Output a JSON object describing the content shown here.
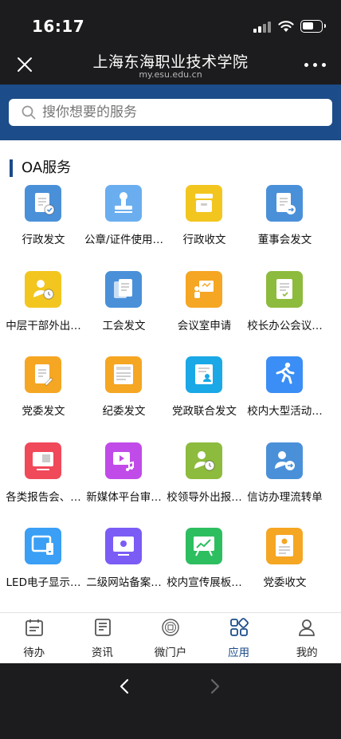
{
  "status": {
    "time": "16:17"
  },
  "header": {
    "title": "上海东海职业技术学院",
    "url": "my.esu.edu.cn"
  },
  "search": {
    "placeholder": "搜你想要的服务"
  },
  "section": {
    "title": "OA服务"
  },
  "apps": [
    {
      "label": "行政发文",
      "icon": "document-check-icon",
      "color": "#4a90d9"
    },
    {
      "label": "公章/证件使用…",
      "icon": "stamp-icon",
      "color": "#6aaef0"
    },
    {
      "label": "行政收文",
      "icon": "inbox-tray-icon",
      "color": "#f2c61f"
    },
    {
      "label": "董事会发文",
      "icon": "document-send-icon",
      "color": "#4a90d9"
    },
    {
      "label": "中层干部外出…",
      "icon": "person-clock-icon",
      "color": "#f2c61f"
    },
    {
      "label": "工会发文",
      "icon": "documents-icon",
      "color": "#4a90d9"
    },
    {
      "label": "会议室申请",
      "icon": "meeting-board-icon",
      "color": "#f5a623"
    },
    {
      "label": "校长办公会议…",
      "icon": "clipboard-check-icon",
      "color": "#8dbb3d"
    },
    {
      "label": "党委发文",
      "icon": "document-pen-icon",
      "color": "#f5a623"
    },
    {
      "label": "纪委发文",
      "icon": "form-icon",
      "color": "#f5a623"
    },
    {
      "label": "党政联合发文",
      "icon": "document-person-icon",
      "color": "#1aa8e6"
    },
    {
      "label": "校内大型活动…",
      "icon": "running-person-icon",
      "color": "#3a8ef5"
    },
    {
      "label": "各类报告会、…",
      "icon": "qr-presentation-icon",
      "color": "#f0495a"
    },
    {
      "label": "新媒体平台审…",
      "icon": "media-play-icon",
      "color": "#c14be8"
    },
    {
      "label": "校领导外出报…",
      "icon": "person-clock-icon",
      "color": "#8dbb3d"
    },
    {
      "label": "信访办理流转单",
      "icon": "person-transfer-icon",
      "color": "#4a90d9"
    },
    {
      "label": "LED电子显示…",
      "icon": "display-screen-icon",
      "color": "#3a9ff5"
    },
    {
      "label": "二级网站备案…",
      "icon": "monitor-icon",
      "color": "#7b5cf5"
    },
    {
      "label": "校内宣传展板…",
      "icon": "chart-board-icon",
      "color": "#2dbe60"
    },
    {
      "label": "党委收文",
      "icon": "document-badge-icon",
      "color": "#f5a623"
    }
  ],
  "tabs": [
    {
      "label": "待办",
      "icon": "calendar-icon",
      "active": false
    },
    {
      "label": "资讯",
      "icon": "news-icon",
      "active": false
    },
    {
      "label": "微门户",
      "icon": "school-emblem-icon",
      "active": false
    },
    {
      "label": "应用",
      "icon": "apps-grid-icon",
      "active": true
    },
    {
      "label": "我的",
      "icon": "user-icon",
      "active": false
    }
  ],
  "colors": {
    "accent": "#1c4c89",
    "dark_bar": "#1c1c1e"
  }
}
